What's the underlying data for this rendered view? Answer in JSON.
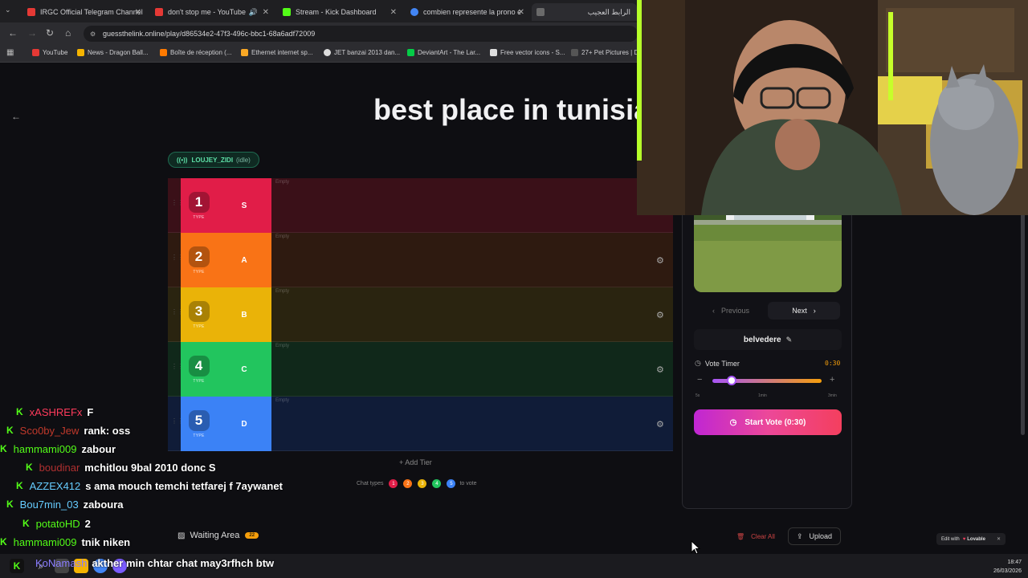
{
  "browser": {
    "tabs": [
      {
        "label": "IRGC Official Telegram Channel",
        "color": "#e53935"
      },
      {
        "label": "don't stop me - YouTube",
        "color": "#e53935"
      },
      {
        "label": "Stream - Kick Dashboard",
        "color": "#53fc18"
      },
      {
        "label": "combien represente la prono e",
        "color": "#4285f4"
      },
      {
        "label": "الرابط العجيب",
        "color": "#6a6a6a"
      }
    ],
    "url": "guessthelink.online/play/d86534e2-47f3-496c-bbc1-68a6adf72009",
    "bookmarks": [
      "YouTube",
      "News - Dragon Ball...",
      "Boîte de réception (...",
      "Ethernet internet sp...",
      "JET banzai 2013 dan...",
      "DeviantArt - The Lar...",
      "Free vector icons - S...",
      "27+ Pet Pictures | D"
    ]
  },
  "page": {
    "title": "best place in tunisia",
    "streamer": "LOUJEY_ZIDI",
    "streamer_status": "(idle)",
    "tiers": [
      {
        "num": "1",
        "type": "TYPE",
        "letter": "S",
        "empty": "Empty",
        "color": "#e11d48",
        "bg": "#3a1018"
      },
      {
        "num": "2",
        "type": "TYPE",
        "letter": "A",
        "empty": "Empty",
        "color": "#f97316",
        "bg": "#2e1a10"
      },
      {
        "num": "3",
        "type": "TYPE",
        "letter": "B",
        "empty": "Empty",
        "color": "#eab308",
        "bg": "#2a2410"
      },
      {
        "num": "4",
        "type": "TYPE",
        "letter": "C",
        "empty": "Empty",
        "color": "#22c55e",
        "bg": "#10281a"
      },
      {
        "num": "5",
        "type": "TYPE",
        "letter": "D",
        "empty": "Empty",
        "color": "#3b82f6",
        "bg": "#101c38"
      }
    ],
    "add_tier": "Add Tier",
    "chat_types_label": "Chat types",
    "to_vote_label": "to vote",
    "waiting_area": "Waiting Area",
    "waiting_count": "22",
    "clear_all": "Clear All",
    "upload": "Upload"
  },
  "side": {
    "previous": "Previous",
    "next": "Next",
    "item_name": "belvedere",
    "vote_timer_label": "Vote Timer",
    "vote_timer_value": "0:30",
    "ticks": [
      "5s",
      "1min",
      "3min"
    ],
    "start_vote": "Start Vote (0:30)"
  },
  "chat": [
    {
      "user": "xASHREFx",
      "msg": "F",
      "color": "#ff3b5c"
    },
    {
      "user": "Sco0by_Jew",
      "msg": "rank: oss",
      "color": "#c0392b"
    },
    {
      "user": "hammami009",
      "msg": "zabour",
      "color": "#53fc18"
    },
    {
      "user": "boudinar",
      "msg": "mchitlou 9bal 2010 donc S",
      "color": "#b03030"
    },
    {
      "user": "AZZEX412",
      "msg": "s ama mouch temchi tetfarej f 7aywanet",
      "color": "#66ccff"
    },
    {
      "user": "Bou7min_03",
      "msg": "zaboura",
      "color": "#66ccff"
    },
    {
      "user": "potatoHD",
      "msg": "2",
      "color": "#53fc18"
    },
    {
      "user": "hammami009",
      "msg": "tnik niken",
      "color": "#53fc18"
    },
    {
      "user": "KoNamash",
      "msg": "akther min chtar chat may3rfhch btw",
      "color": "#8a7dff"
    }
  ],
  "lovable": {
    "edit_with": "Edit with",
    "brand": "Lovable"
  },
  "taskbar": {
    "time": "18:47",
    "date": "26/03/2026"
  }
}
